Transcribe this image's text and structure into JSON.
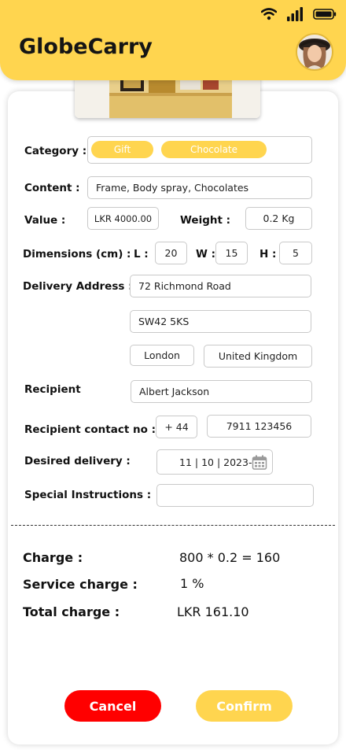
{
  "app": {
    "title": "GlobeCarry"
  },
  "colors": {
    "accent": "#FFD54F",
    "cancel": "#FF0000",
    "text": "#111111"
  },
  "status_bar": {
    "icons": [
      "wifi-icon",
      "signal-icon",
      "battery-icon"
    ]
  },
  "form": {
    "category": {
      "label": "Category :",
      "tags": [
        "Gift",
        "Chocolate"
      ]
    },
    "content": {
      "label": "Content :",
      "value": "Frame, Body spray, Chocolates"
    },
    "value": {
      "label": "Value :",
      "value": "LKR 4000.00"
    },
    "weight": {
      "label": "Weight :",
      "value": "0.2 Kg"
    },
    "dimensions": {
      "label": "Dimensions (cm) :",
      "l_label": "L :",
      "l": "20",
      "w_label": "W :",
      "w": "15",
      "h_label": "H :",
      "h": "5"
    },
    "address": {
      "label": "Delivery Address :",
      "line1": "72 Richmond Road",
      "postcode": "SW42 5KS",
      "city": "London",
      "country": "United Kingdom"
    },
    "recipient": {
      "label": "Recipient",
      "value": "Albert Jackson"
    },
    "contact": {
      "label": "Recipient contact no :",
      "code": "+ 44",
      "number": "7911 123456"
    },
    "delivery": {
      "label": "Desired delivery :",
      "value": "11 | 10 | 2023-"
    },
    "instructions": {
      "label": "Special Instructions :",
      "value": ""
    }
  },
  "summary": {
    "charge": {
      "label": "Charge :",
      "value": "800  *  0.2 = 160"
    },
    "service": {
      "label": "Service charge :",
      "value": "1 %"
    },
    "total": {
      "label": "Total charge :",
      "value": "LKR 161.10"
    }
  },
  "actions": {
    "cancel": "Cancel",
    "confirm": "Confirm"
  }
}
